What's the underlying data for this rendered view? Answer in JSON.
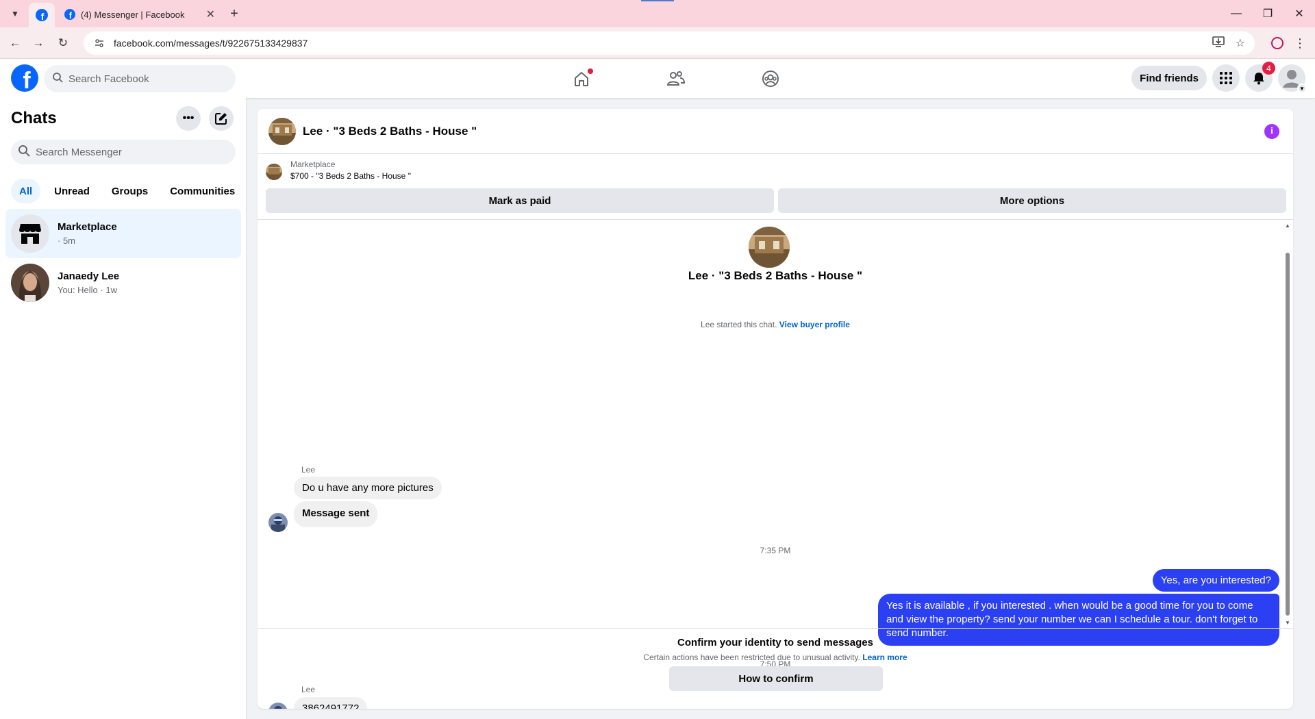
{
  "browser": {
    "tab_title": "(4) Messenger | Facebook",
    "url": "facebook.com/messages/t/922675133429837"
  },
  "fb": {
    "search_placeholder": "Search Facebook",
    "find_friends": "Find friends",
    "notification_count": "4",
    "brand_color": "#0866ff"
  },
  "sidebar": {
    "title": "Chats",
    "search_placeholder": "Search Messenger",
    "filters": [
      "All",
      "Unread",
      "Groups",
      "Communities"
    ],
    "chats": [
      {
        "name": "Marketplace",
        "sub": "· 5m"
      },
      {
        "name": "Janaedy Lee",
        "sub": "You: Hello · 1w"
      }
    ]
  },
  "conversation": {
    "title": "Lee · \"3 Beds 2 Baths - House \"",
    "marketplace_label": "Marketplace",
    "listing": "$700 - \"3 Beds 2 Baths - House \"",
    "mark_paid": "Mark as paid",
    "more_options": "More options",
    "center_title": "Lee · \"3 Beds 2 Baths - House \"",
    "started_text": "Lee started this chat.",
    "view_buyer": "View buyer profile",
    "messages": [
      {
        "sender": "Lee",
        "text": "Do u have any more pictures"
      },
      {
        "text": "Message sent"
      },
      {
        "time": "7:35 PM"
      },
      {
        "text": "Yes, are you interested?"
      },
      {
        "text": "Yes it is available , if you interested . when would be  a good time for you to come and view the  property? send your number we can I schedule  a tour. don't forget to send  number."
      },
      {
        "time": "7:50 PM"
      },
      {
        "sender": "Lee",
        "text": "3862491772"
      }
    ],
    "confirm_title": "Confirm your identity to send messages",
    "confirm_sub": "Certain actions have been restricted due to unusual activity.",
    "learn_more": "Learn more",
    "how_to_confirm": "How to confirm",
    "outgoing_color": "#2b3ff3"
  }
}
